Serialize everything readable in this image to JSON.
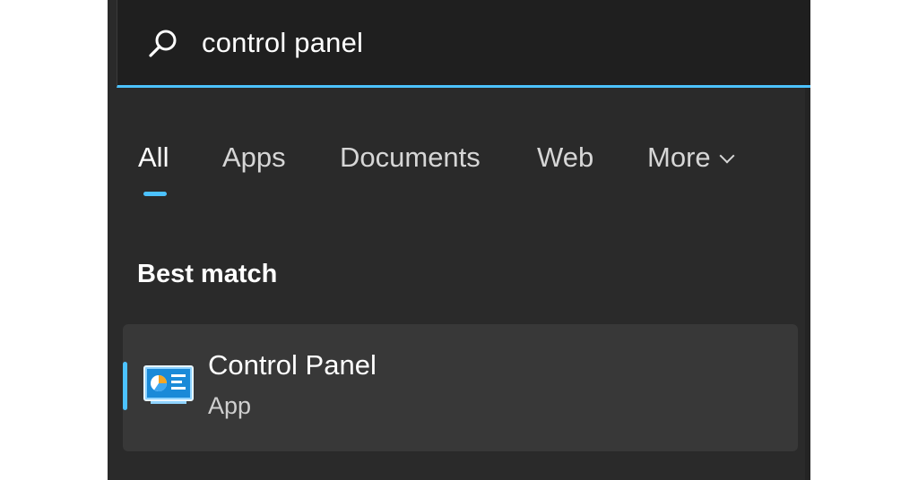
{
  "search": {
    "query": "control panel",
    "icon": "search-icon",
    "accent_color": "#4cc2ff"
  },
  "tabs": [
    {
      "label": "All",
      "active": true
    },
    {
      "label": "Apps",
      "active": false
    },
    {
      "label": "Documents",
      "active": false
    },
    {
      "label": "Web",
      "active": false
    },
    {
      "label": "More",
      "active": false,
      "icon": "chevron-down-icon"
    }
  ],
  "results": {
    "section_title": "Best match",
    "best_match": {
      "title": "Control Panel",
      "subtitle": "App",
      "icon": "control-panel-icon"
    }
  },
  "theme": {
    "background": "#2a2a2a",
    "search_background": "#1f1f1f",
    "card_background": "#383838",
    "accent": "#4cc2ff"
  }
}
